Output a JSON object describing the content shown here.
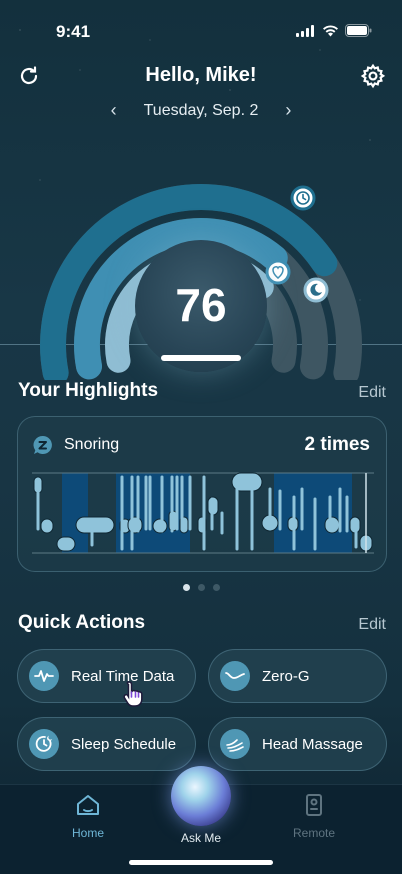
{
  "status_bar": {
    "time": "9:41"
  },
  "header": {
    "greeting": "Hello, Mike!",
    "date": "Tuesday, Sep. 2"
  },
  "score": {
    "value": "76",
    "rings": [
      {
        "color": "#1f6f8f",
        "fraction": 0.78
      },
      {
        "color": "#3f8fb3",
        "fraction": 0.7
      },
      {
        "color": "#8fbdd3",
        "fraction": 0.73
      }
    ]
  },
  "highlights": {
    "title": "Your Highlights",
    "edit_label": "Edit",
    "card": {
      "label": "Snoring",
      "value": "2 times",
      "icon": "snore-icon"
    },
    "pages": 3,
    "active_page": 0
  },
  "quick_actions": {
    "title": "Quick Actions",
    "edit_label": "Edit",
    "items": [
      {
        "label": "Real Time Data",
        "icon": "heartbeat-icon"
      },
      {
        "label": "Zero-G",
        "icon": "zero-g-icon"
      },
      {
        "label": "Sleep Schedule",
        "icon": "clock-moon-icon"
      },
      {
        "label": "Head Massage",
        "icon": "massage-icon"
      }
    ]
  },
  "tabbar": {
    "home_label": "Home",
    "askme_label": "Ask Me",
    "remote_label": "Remote",
    "active_color": "#6fb6d6",
    "inactive_color": "#5f7480"
  }
}
